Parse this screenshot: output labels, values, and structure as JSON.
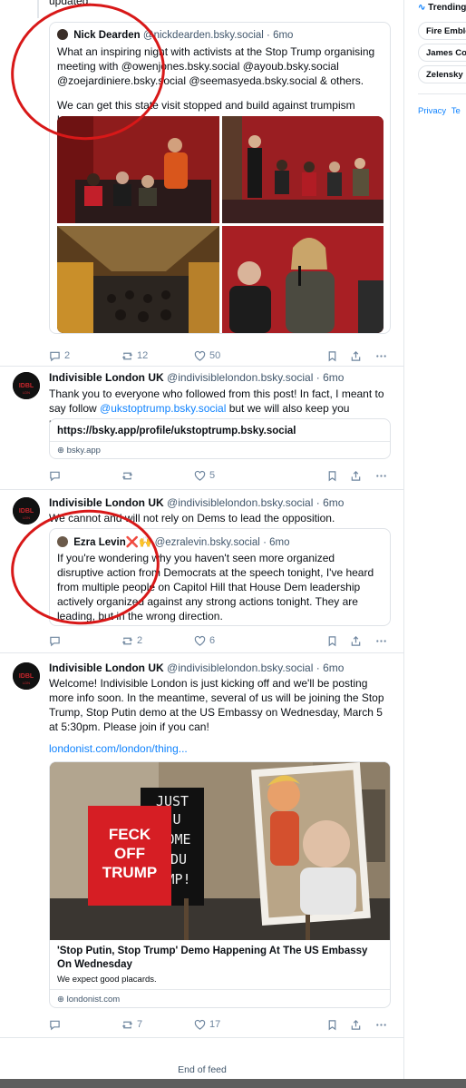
{
  "sidebar": {
    "trending_label": "Trending",
    "trends": [
      "Fire Emble",
      "James Co",
      "Zelensky"
    ],
    "footer_link": "Privacy",
    "footer_link2": "Te"
  },
  "top_fragment": "updated.",
  "quote1": {
    "name": "Nick Dearden",
    "handle": "@nickdearden.bsky.social",
    "time": "· 6mo",
    "text1": "What an inspiring night with activists at the Stop Trump organising meeting with @owenjones.bsky.social @ayoub.bsky.social @zoejardiniere.bsky.social @seemasyeda.bsky.social & others.",
    "text2": "We can get this state visit stopped and build against trumpism here."
  },
  "post1_actions": {
    "replies": "2",
    "reposts": "12",
    "likes": "50"
  },
  "post2": {
    "name": "Indivisible London UK",
    "handle": "@indivisiblelondon.bsky.social",
    "time": "· 6mo",
    "text_a": "Thank you to everyone who followed from this post! In fact, I meant to say follow ",
    "text_link": "@ukstoptrump.bsky.social",
    "text_b": " but we will also keep you updated!",
    "card_title": "https://bsky.app/profile/ukstoptrump.bsky.social",
    "card_domain": "bsky.app",
    "likes": "5"
  },
  "post3": {
    "name": "Indivisible London UK",
    "handle": "@indivisiblelondon.bsky.social",
    "time": "· 6mo",
    "text": "We cannot and will not rely on Dems to lead the opposition.",
    "q_name": "Ezra Levin",
    "q_emoji": "❌🙌",
    "q_handle": "@ezralevin.bsky.social",
    "q_time": "· 6mo",
    "q_text": "If you're wondering why you haven't seen more organized disruptive action from Democrats at the speech tonight, I've heard from multiple people on Capitol Hill that House Dem  leadership actively organized against any strong actions tonight. They are leading, but in the wrong direction.",
    "reposts": "2",
    "likes": "6"
  },
  "post4": {
    "name": "Indivisible London UK",
    "handle": "@indivisiblelondon.bsky.social",
    "time": "· 6mo",
    "text": "Welcome! Indivisible London is just kicking off and we'll be posting more info soon. In the meantime, several of us will be joining the Stop Trump, Stop Putin demo at the US Embassy on Wednesday, March 5 at 5:30pm. Please join if you can!",
    "link": "londonist.com/london/thing...",
    "card_title": "'Stop Putin, Stop Trump' Demo Happening At The US Embassy On Wednesday",
    "card_desc": "We expect good placards.",
    "card_domain": "londonist.com",
    "placard_lines": [
      "FECK",
      "OFF",
      "TRUMP"
    ],
    "banner_lines": [
      "JUST",
      "U",
      "OME",
      "DU",
      "MP!"
    ],
    "reposts": "7",
    "likes": "17"
  },
  "end_of_feed": "End of feed",
  "colors": {
    "accent": "#1083fe",
    "annotation": "#d81818",
    "muted": "#6f869f"
  }
}
